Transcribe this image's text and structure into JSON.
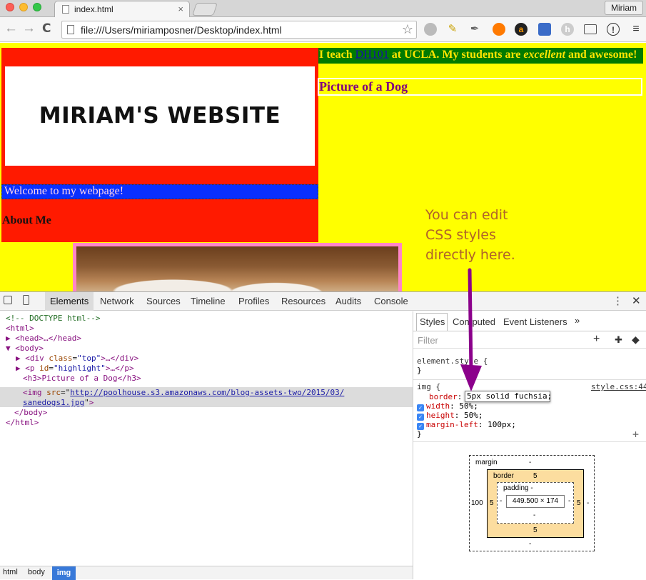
{
  "tab": {
    "title": "index.html",
    "close": "×"
  },
  "user": {
    "name": "Miriam"
  },
  "toolbar": {
    "back": "←",
    "forward": "→",
    "reload": "C",
    "url": "file:///Users/miriamposner/Desktop/index.html",
    "star": "☆"
  },
  "page": {
    "logo_text": "MIRIAM'S WEBSITE",
    "welcome": "Welcome to my webpage!",
    "about": "About Me",
    "highlight_pre": "I teach ",
    "highlight_link": "DH101",
    "highlight_mid": " at UCLA. My students are ",
    "highlight_em": "excellent",
    "highlight_and": " and ",
    "highlight_strong": "awesome",
    "highlight_end": "!",
    "h3": "Picture of a Dog"
  },
  "annotation": {
    "line1": "You can edit",
    "line2": "CSS styles",
    "line3": "directly here."
  },
  "devtools": {
    "tabs": [
      "Elements",
      "Network",
      "Sources",
      "Timeline",
      "Profiles",
      "Resources",
      "Audits",
      "Console"
    ],
    "active_tab": "Elements",
    "dom": {
      "doctype": "<!-- DOCTYPE html-->",
      "html_open": "<html>",
      "head": "<head>…</head>",
      "body_open": "<body>",
      "div_tag": "div",
      "div_attr": "class",
      "div_val": "\"top\"",
      "div_rest": ">…</div>",
      "p_tag": "p",
      "p_attr": "id",
      "p_val": "\"highlight\"",
      "p_rest": ">…</p>",
      "h3": "<h3>Picture of a Dog</h3>",
      "img_tag": "img",
      "img_attr": "src",
      "img_url1": "http://poolhouse.s3.amazonaws.com/blog-assets-two/2015/03/",
      "img_url2": "sanedogs1.jpg",
      "body_close": "</body>",
      "html_close": "</html>"
    },
    "breadcrumbs": [
      "html",
      "body",
      "img"
    ],
    "side_tabs": [
      "Styles",
      "Computed",
      "Event Listeners",
      "»"
    ],
    "filter_placeholder": "Filter",
    "element_style": "element.style {",
    "close_brace": "}",
    "img_rule": {
      "selector": "img {",
      "source": "style.css:44",
      "border_prop": "border",
      "border_val": "5px solid fuchsia;",
      "width_prop": "width",
      "width_val": "50%;",
      "height_prop": "height",
      "height_val": "50%;",
      "margin_prop": "margin-left",
      "margin_val": "100px;"
    },
    "box_model": {
      "margin_label": "margin",
      "margin_top": "-",
      "margin_bottom": "-",
      "margin_left": "100",
      "margin_right": "-",
      "border_label": "border",
      "border_top": "5",
      "border_bottom": "5",
      "border_left": "5",
      "border_right": "5",
      "padding_label": "padding -",
      "padding_bottom": "-",
      "padding_left": "-",
      "padding_right": "-",
      "content": "449.500 × 174"
    }
  },
  "colors": {
    "page_bg": "#ffff00",
    "top_bg": "#ff1a00",
    "highlight_bg": "#007a00",
    "welcome_bg": "#0a2fff",
    "h3_color": "#800080",
    "img_border": "#ff85c8",
    "annotation": "#b0622a",
    "arrow": "#8b008b"
  }
}
